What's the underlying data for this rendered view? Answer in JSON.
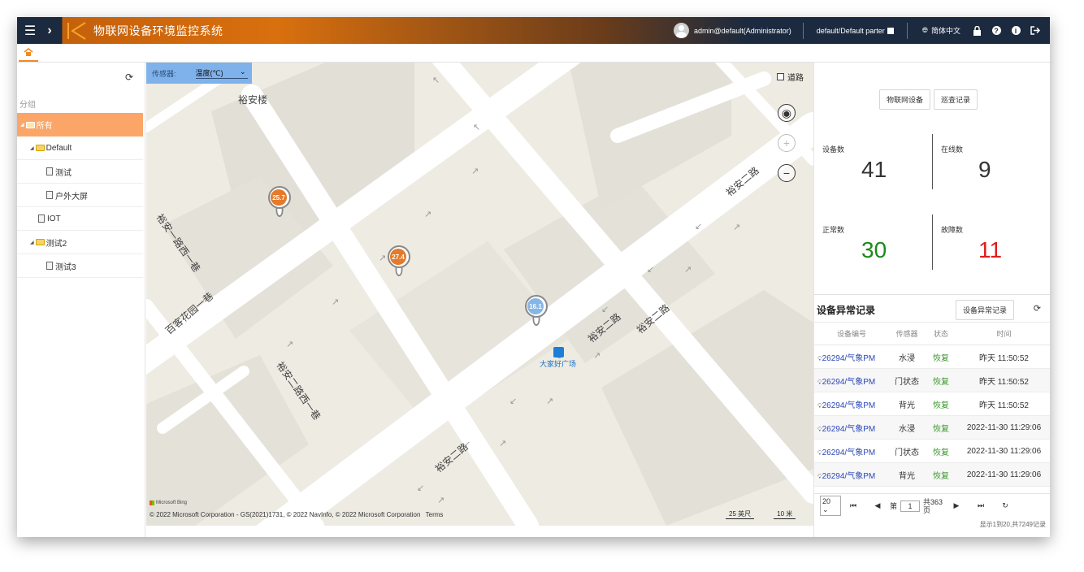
{
  "header": {
    "title": "物联网设备环境监控系统",
    "user": "admin@default(Administrator)",
    "tenant": "default/Default parter",
    "language": "简体中文"
  },
  "tree": {
    "group_label": "分组",
    "items": [
      {
        "label": "所有",
        "type": "folder",
        "level": 0,
        "expanded": true,
        "active": true
      },
      {
        "label": "Default",
        "type": "folder",
        "level": 1,
        "expanded": true,
        "active": false
      },
      {
        "label": "测试",
        "type": "doc",
        "level": 2,
        "active": false
      },
      {
        "label": "户外大屏",
        "type": "doc",
        "level": 2,
        "active": false
      },
      {
        "label": "IOT",
        "type": "doc",
        "level": 1,
        "active": false
      },
      {
        "label": "测试2",
        "type": "folder",
        "level": 1,
        "expanded": true,
        "active": false
      },
      {
        "label": "测试3",
        "type": "doc",
        "level": 2,
        "active": false
      }
    ]
  },
  "map": {
    "sensor_label": "传感器:",
    "sensor_value": "温度(℃)",
    "road_label": "道路",
    "labels": [
      "裕安楼",
      "裕安一路西一巷",
      "百客花园一巷",
      "裕安二路西一巷",
      "裕安二路",
      "裕安二路",
      "裕安二路",
      "大家好广场"
    ],
    "pins": [
      {
        "value": "25.7",
        "color": "orange"
      },
      {
        "value": "27.4",
        "color": "orange"
      },
      {
        "value": "16.1",
        "color": "blue"
      }
    ],
    "bing_text": "Microsoft Bing",
    "copyright": "© 2022 Microsoft Corporation - GS(2021)1731, © 2022 NavInfo, © 2022 Microsoft Corporation",
    "terms": "Terms",
    "scale_ft": "25 英尺",
    "scale_m": "10 米"
  },
  "stats": {
    "buttons": [
      "物联网设备",
      "巡查记录"
    ],
    "device_count_label": "设备数",
    "device_count": "41",
    "online_label": "在线数",
    "online": "9",
    "normal_label": "正常数",
    "normal": "30",
    "fault_label": "故障数",
    "fault": "11",
    "colors": {
      "normal": "#1a8a1a",
      "fault": "#e01c1c"
    }
  },
  "alarms": {
    "title": "设备异常记录",
    "button": "设备异常记录",
    "columns": [
      "设备编号",
      "传感器",
      "状态",
      "时间"
    ],
    "rows": [
      {
        "device": "26294/气象PM",
        "sensor": "水浸",
        "status": "恢复",
        "time": "昨天 11:50:52"
      },
      {
        "device": "26294/气象PM",
        "sensor": "门状态",
        "status": "恢复",
        "time": "昨天 11:50:52"
      },
      {
        "device": "26294/气象PM",
        "sensor": "背光",
        "status": "恢复",
        "time": "昨天 11:50:52"
      },
      {
        "device": "26294/气象PM",
        "sensor": "水浸",
        "status": "恢复",
        "time": "2022-11-30 11:29:06"
      },
      {
        "device": "26294/气象PM",
        "sensor": "门状态",
        "status": "恢复",
        "time": "2022-11-30 11:29:06"
      },
      {
        "device": "26294/气象PM",
        "sensor": "背光",
        "status": "恢复",
        "time": "2022-11-30 11:29:06"
      }
    ],
    "pager": {
      "page_size": "20",
      "page_prefix": "第",
      "page": "1",
      "page_total": "共363页",
      "info": "显示1到20,共7249记录"
    }
  }
}
